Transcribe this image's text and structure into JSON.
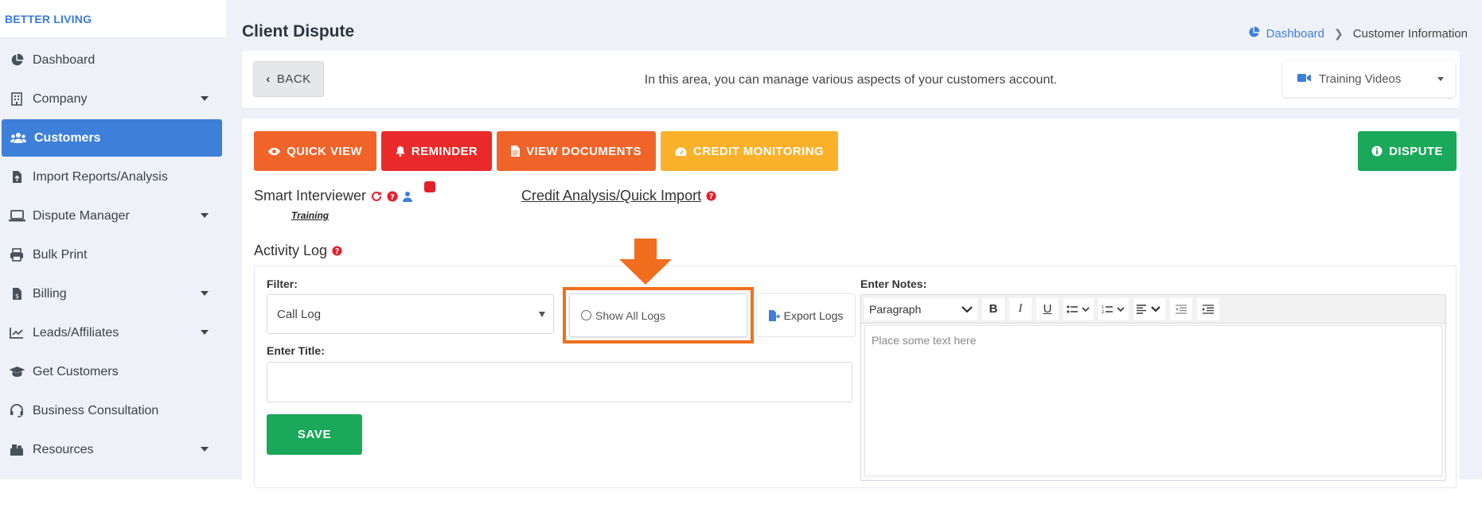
{
  "sidebar": {
    "brand": "BETTER LIVING",
    "items": [
      {
        "label": "Dashboard",
        "icon": "pie-chart-icon",
        "caret": false,
        "active": false
      },
      {
        "label": "Company",
        "icon": "building-icon",
        "caret": true,
        "active": false
      },
      {
        "label": "Customers",
        "icon": "users-icon",
        "caret": false,
        "active": true
      },
      {
        "label": "Import Reports/Analysis",
        "icon": "file-import-icon",
        "caret": false,
        "active": false
      },
      {
        "label": "Dispute Manager",
        "icon": "laptop-icon",
        "caret": true,
        "active": false
      },
      {
        "label": "Bulk Print",
        "icon": "printer-icon",
        "caret": false,
        "active": false
      },
      {
        "label": "Billing",
        "icon": "invoice-icon",
        "caret": true,
        "active": false
      },
      {
        "label": "Leads/Affiliates",
        "icon": "line-chart-icon",
        "caret": true,
        "active": false
      },
      {
        "label": "Get Customers",
        "icon": "graduation-cap-icon",
        "caret": false,
        "active": false
      },
      {
        "label": "Business Consultation",
        "icon": "headset-icon",
        "caret": false,
        "active": false
      },
      {
        "label": "Resources",
        "icon": "box-icon",
        "caret": true,
        "active": false
      }
    ]
  },
  "header": {
    "title": "Client Dispute",
    "breadcrumb": {
      "home": "Dashboard",
      "current": "Customer Information"
    }
  },
  "topbar": {
    "back_label": "BACK",
    "message": "In this area, you can manage various aspects of your customers account.",
    "training_videos": "Training Videos"
  },
  "actions": {
    "quick_view": "QUICK VIEW",
    "reminder": "REMINDER",
    "view_documents": "VIEW DOCUMENTS",
    "credit_monitoring": "CREDIT MONITORING",
    "dispute": "DISPUTE"
  },
  "smart_interviewer": {
    "label": "Smart Interviewer",
    "training": "Training"
  },
  "credit_analysis": {
    "label": "Credit Analysis/Quick Import"
  },
  "activity_log": {
    "title": "Activity Log",
    "filter_label": "Filter:",
    "filter_value": "Call Log",
    "show_all_logs": "Show All Logs",
    "export_logs": "Export Logs",
    "enter_title_label": "Enter Title:",
    "title_value": "",
    "save_label": "SAVE",
    "notes_label": "Enter Notes:",
    "editor": {
      "paragraph": "Paragraph",
      "placeholder": "Place some text here"
    }
  },
  "colors": {
    "primary": "#3d7fd9",
    "orange": "#f0642a",
    "red": "#ea2a2a",
    "amber": "#fbb12a",
    "green": "#1aa85a",
    "annotation": "#f06e1e"
  }
}
